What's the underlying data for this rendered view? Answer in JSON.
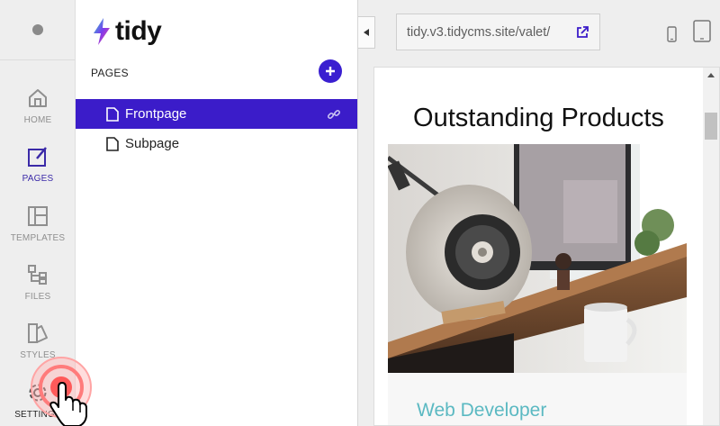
{
  "rail": {
    "items": [
      {
        "label": "HOME",
        "icon": "home-icon"
      },
      {
        "label": "PAGES",
        "icon": "pages-icon",
        "active": true
      },
      {
        "label": "TEMPLATES",
        "icon": "templates-icon"
      },
      {
        "label": "FILES",
        "icon": "files-icon"
      },
      {
        "label": "STYLES",
        "icon": "styles-icon"
      },
      {
        "label": "SETTINGS",
        "icon": "gear-icon"
      }
    ]
  },
  "panel": {
    "logo_text": "tidy",
    "heading": "PAGES",
    "pages": [
      {
        "label": "Frontpage",
        "selected": true
      },
      {
        "label": "Subpage",
        "selected": false
      }
    ]
  },
  "preview": {
    "url": "tidy.v3.tidycms.site/valet/",
    "frame_title": "Outstanding Products",
    "card_title": "Web Developer"
  },
  "colors": {
    "accent": "#3b1cc9",
    "card_title": "#5bb9c2",
    "click_ring": "#ff6b6b"
  }
}
